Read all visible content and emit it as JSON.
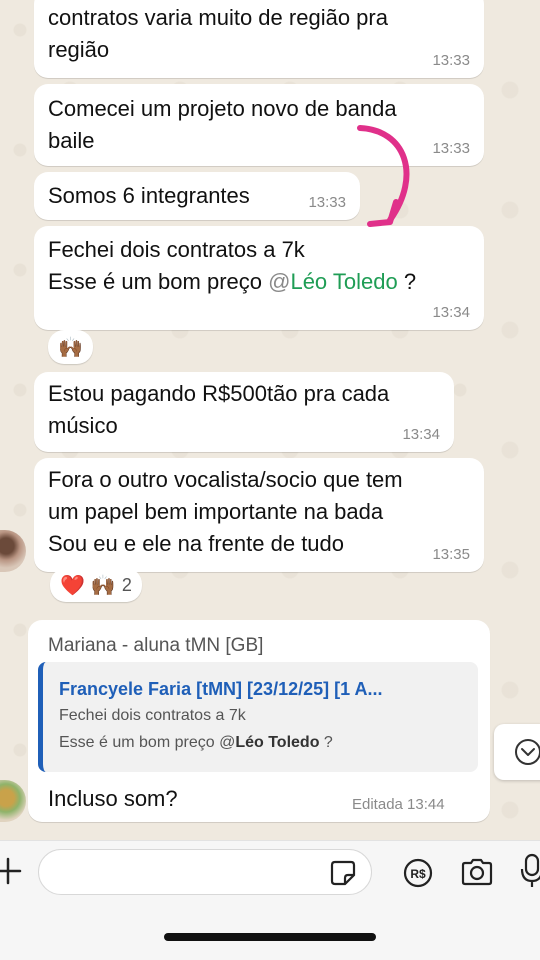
{
  "messages": [
    {
      "text": "contratos varia muito de região pra\nregião",
      "time": "13:33"
    },
    {
      "text": "Comecei um projeto novo de banda\nbaile",
      "time": "13:33"
    },
    {
      "text": "Somos 6 integrantes",
      "time": "13:33"
    },
    {
      "line1": "Fechei dois contratos a 7k",
      "line2_prefix": "Esse é um bom preço ",
      "mention_at": "@",
      "mention_name": "Léo Toledo",
      "line2_suffix": " ?",
      "time": "13:34",
      "reaction": "🙌🏾"
    },
    {
      "text": "Estou pagando R$500tão pra cada\nmúsico",
      "time": "13:34"
    },
    {
      "text": "Fora o outro vocalista/socio que tem\num papel bem importante na bada\nSou eu e ele na frente de tudo",
      "time": "13:35",
      "reactions": [
        "❤️",
        "🙌🏾"
      ],
      "reaction_count": "2"
    }
  ],
  "reply": {
    "sender": "Mariana - aluna tMN [GB]",
    "quote_author": "Francyele Faria [tMN] [23/12/25] [1 A...",
    "quote_line1": "Fechei dois contratos a 7k",
    "quote_line2_prefix": "Esse é um bom preço ",
    "quote_mention_at": "@",
    "quote_mention_name": "Léo Toledo",
    "quote_line2_suffix": " ?",
    "text": "Incluso som?",
    "edited": "Editada",
    "time": "13:44"
  },
  "colors": {
    "mention": "#1f9d55",
    "quote_accent": "#1f5fb8",
    "arrow": "#e0308a"
  },
  "icons": [
    "plus-icon",
    "sticker-icon",
    "pix-icon",
    "camera-icon",
    "microphone-icon",
    "chevron-down-icon",
    "arrow-annotation-icon"
  ]
}
